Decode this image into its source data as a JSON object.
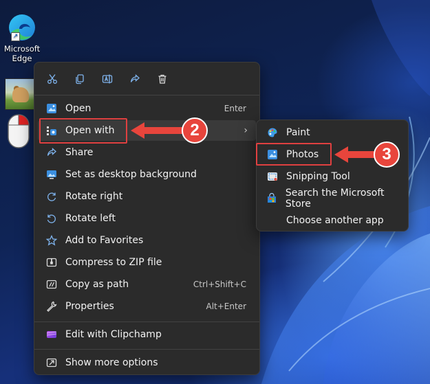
{
  "desktop": {
    "edge_label": "Microsoft Edge"
  },
  "toolbar": {
    "icons": [
      "cut-icon",
      "copy-icon",
      "rename-icon",
      "share-icon",
      "delete-icon"
    ]
  },
  "menu": {
    "items": [
      {
        "label": "Open",
        "shortcut": "Enter",
        "icon": "open-icon"
      },
      {
        "label": "Open with",
        "shortcut": "",
        "icon": "open-with-icon",
        "has_submenu": true
      },
      {
        "label": "Share",
        "shortcut": "",
        "icon": "share-icon"
      },
      {
        "label": "Set as desktop background",
        "shortcut": "",
        "icon": "desktop-background-icon"
      },
      {
        "label": "Rotate right",
        "shortcut": "",
        "icon": "rotate-right-icon"
      },
      {
        "label": "Rotate left",
        "shortcut": "",
        "icon": "rotate-left-icon"
      },
      {
        "label": "Add to Favorites",
        "shortcut": "",
        "icon": "star-icon"
      },
      {
        "label": "Compress to ZIP file",
        "shortcut": "",
        "icon": "zip-icon"
      },
      {
        "label": "Copy as path",
        "shortcut": "Ctrl+Shift+C",
        "icon": "copy-path-icon"
      },
      {
        "label": "Properties",
        "shortcut": "Alt+Enter",
        "icon": "wrench-icon"
      },
      {
        "label": "Edit with Clipchamp",
        "shortcut": "",
        "icon": "clipchamp-icon"
      },
      {
        "label": "Show more options",
        "shortcut": "",
        "icon": "more-options-icon"
      }
    ]
  },
  "submenu": {
    "items": [
      {
        "label": "Paint",
        "icon": "paint-icon"
      },
      {
        "label": "Photos",
        "icon": "photos-icon"
      },
      {
        "label": "Snipping Tool",
        "icon": "snipping-tool-icon"
      },
      {
        "label": "Search the Microsoft Store",
        "icon": "store-icon"
      },
      {
        "label": "Choose another app",
        "icon": ""
      }
    ]
  },
  "annotations": {
    "step2": "2",
    "step3": "3",
    "color": "#e8453c"
  }
}
